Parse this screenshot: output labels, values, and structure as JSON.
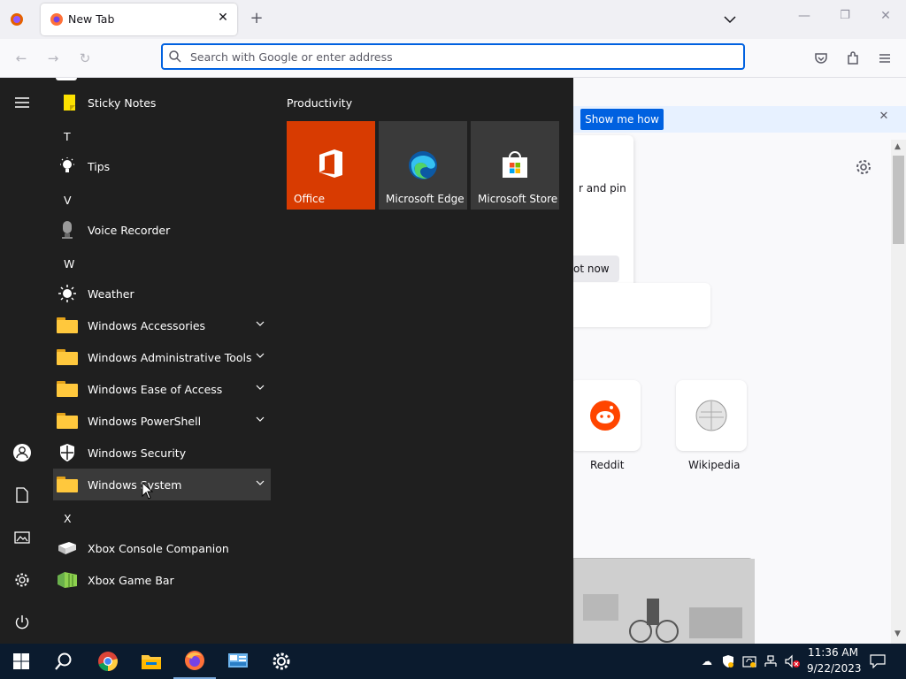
{
  "browser": {
    "tab_title": "New Tab",
    "new_tab_symbol": "+",
    "url_placeholder": "Search with Google or enter address"
  },
  "newtab": {
    "show_me_how": "Show me how",
    "popup_text_fragment": "r and pin",
    "not_now_fragment": "ot now",
    "shortcuts": [
      {
        "label": "Reddit",
        "icon": "reddit-icon"
      },
      {
        "label": "Wikipedia",
        "icon": "wikipedia-icon"
      }
    ]
  },
  "startmenu": {
    "apps": [
      {
        "label": "Sticky Notes",
        "icon": "sticky-notes-icon"
      },
      {
        "label": "Tips",
        "icon": "tips-icon"
      },
      {
        "label": "Voice Recorder",
        "icon": "voice-recorder-icon"
      },
      {
        "label": "Weather",
        "icon": "weather-icon"
      },
      {
        "label": "Windows Accessories",
        "icon": "folder-icon",
        "expandable": true
      },
      {
        "label": "Windows Administrative Tools",
        "icon": "folder-icon",
        "expandable": true
      },
      {
        "label": "Windows Ease of Access",
        "icon": "folder-icon",
        "expandable": true
      },
      {
        "label": "Windows PowerShell",
        "icon": "folder-icon",
        "expandable": true
      },
      {
        "label": "Windows Security",
        "icon": "shield-icon"
      },
      {
        "label": "Windows System",
        "icon": "folder-icon",
        "expandable": true,
        "hovered": true
      },
      {
        "label": "Xbox Console Companion",
        "icon": "xbox-console-icon"
      },
      {
        "label": "Xbox Game Bar",
        "icon": "xbox-game-bar-icon"
      }
    ],
    "letters": [
      "T",
      "V",
      "W",
      "X"
    ],
    "tiles_group": "Productivity",
    "tiles": [
      {
        "label": "Office",
        "icon": "office-icon",
        "color": "#d83b01"
      },
      {
        "label": "Microsoft Edge",
        "icon": "edge-icon",
        "color": "#3a3a3a"
      },
      {
        "label": "Microsoft Store",
        "icon": "store-icon",
        "color": "#3a3a3a"
      }
    ]
  },
  "taskbar": {
    "time": "11:36 AM",
    "date": "9/22/2023"
  },
  "colors": {
    "accent": "#0061e0",
    "start_bg": "#1f1f1f",
    "taskbar_bg": "#0b1b2e",
    "folder": "#ffc83d"
  }
}
